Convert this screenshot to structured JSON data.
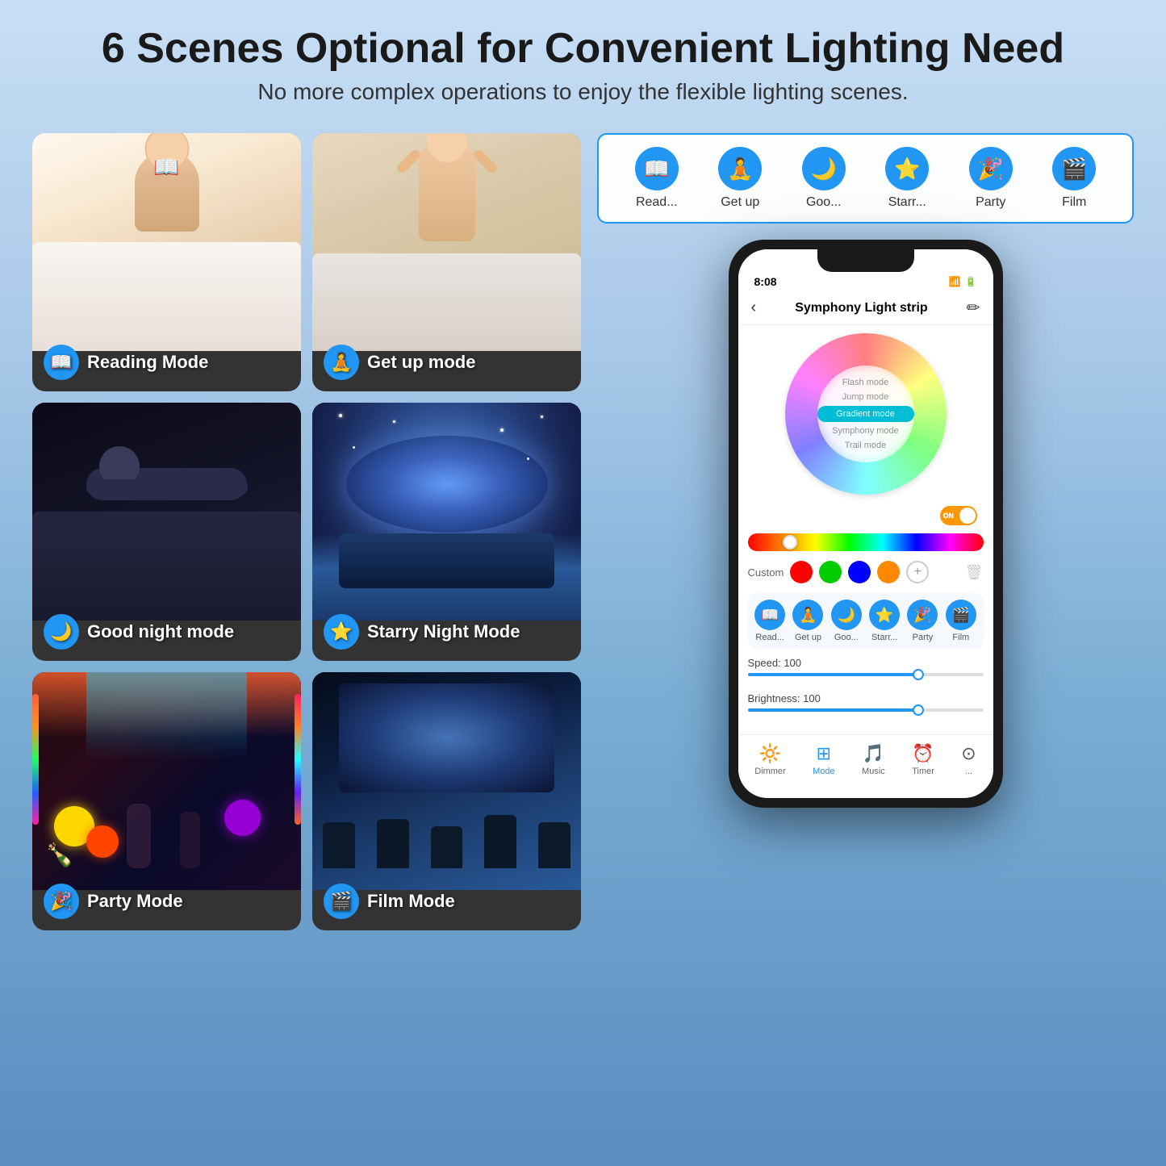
{
  "header": {
    "title": "6 Scenes Optional for Convenient Lighting Need",
    "subtitle": "No more complex operations to enjoy the flexible lighting scenes."
  },
  "scenes": [
    {
      "id": "reading",
      "label": "Reading Mode",
      "icon": "📖"
    },
    {
      "id": "getup",
      "label": "Get up mode",
      "icon": "🧘"
    },
    {
      "id": "goodnight",
      "label": "Good night mode",
      "icon": "🌙"
    },
    {
      "id": "starry",
      "label": "Starry Night Mode",
      "icon": "⭐"
    },
    {
      "id": "party",
      "label": "Party Mode",
      "icon": "🎉"
    },
    {
      "id": "film",
      "label": "Film Mode",
      "icon": "🎬"
    }
  ],
  "scene_selector": {
    "items": [
      {
        "label": "Read...",
        "icon": "📖"
      },
      {
        "label": "Get up",
        "icon": "🧘"
      },
      {
        "label": "Goo...",
        "icon": "🌙"
      },
      {
        "label": "Starr...",
        "icon": "⭐"
      },
      {
        "label": "Party",
        "icon": "🎉"
      },
      {
        "label": "Film",
        "icon": "🎬"
      }
    ]
  },
  "phone": {
    "status_bar": {
      "time": "8:08",
      "wifi": "wifi",
      "battery": "battery"
    },
    "title": "Symphony Light strip",
    "modes": [
      {
        "label": "Flash mode",
        "active": false
      },
      {
        "label": "Jump mode",
        "active": false
      },
      {
        "label": "Gradient mode",
        "active": true
      },
      {
        "label": "Symphony mode",
        "active": false
      },
      {
        "label": "Trail mode",
        "active": false
      }
    ],
    "custom_label": "Custom",
    "custom_colors": [
      "#FF0000",
      "#00CC00",
      "#0000FF",
      "#FF8800"
    ],
    "speed_label": "Speed: 100",
    "brightness_label": "Brightness: 100",
    "bottom_nav": [
      {
        "label": "Dimmer",
        "icon": "🔆",
        "active": false
      },
      {
        "label": "Mode",
        "icon": "⊞",
        "active": true
      },
      {
        "label": "Music",
        "icon": "🎵",
        "active": false
      },
      {
        "label": "Timer",
        "icon": "⏰",
        "active": false
      },
      {
        "label": "...",
        "icon": "⊙",
        "active": false
      }
    ],
    "in_app_scenes": [
      {
        "label": "Read...",
        "icon": "📖"
      },
      {
        "label": "Get up",
        "icon": "🧘"
      },
      {
        "label": "Goo...",
        "icon": "🌙"
      },
      {
        "label": "Starr...",
        "icon": "⭐"
      },
      {
        "label": "Party",
        "icon": "🎉"
      },
      {
        "label": "Film",
        "icon": "🎬"
      }
    ]
  }
}
